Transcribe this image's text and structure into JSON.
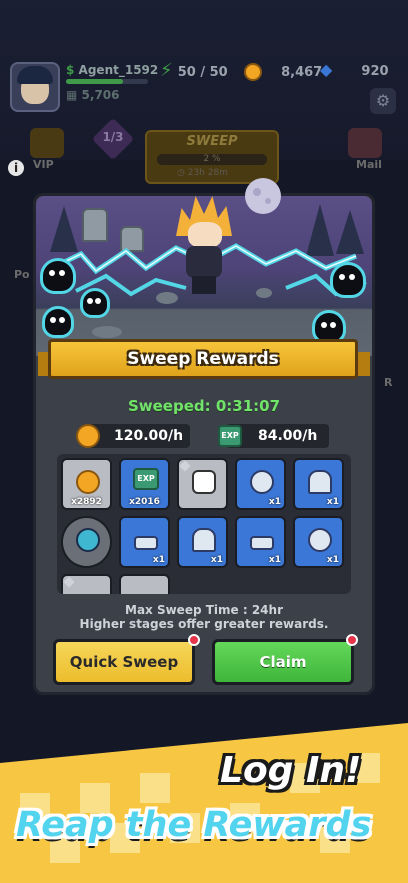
{
  "player": {
    "name": "Agent_1592",
    "power": "5,706",
    "energy": "50 / 50",
    "gold": "8,467",
    "gems": "920"
  },
  "side_menu": {
    "vip_label": "VIP",
    "mail_label": "Mail",
    "left_cut_label": "Po",
    "right_cut_label": "R"
  },
  "sweep_hud": {
    "stage": "1/3",
    "title": "SWEEP",
    "percent": "2 %",
    "timer": "23h 28m"
  },
  "dialog": {
    "title": "Sweep Rewards",
    "sweeped_label": "Sweeped: 0:31:07",
    "gold_rate": "120.00/h",
    "exp_rate": "84.00/h",
    "exp_icon_text": "EXP",
    "rewards": [
      {
        "icon": "gold-coin-icon",
        "qty": "x2892",
        "bg": "gray"
      },
      {
        "icon": "exp-book-icon",
        "qty": "x2016",
        "bg": "blue"
      },
      {
        "icon": "robot-gear-icon",
        "qty": "",
        "bg": "gray"
      },
      {
        "icon": "boots-icon",
        "qty": "x1",
        "bg": "blue"
      },
      {
        "icon": "hat-icon",
        "qty": "x1",
        "bg": "blue"
      },
      {
        "icon": "orb-icon",
        "qty": "",
        "bg": "teal"
      },
      {
        "icon": "belt-icon",
        "qty": "x1",
        "bg": "blue"
      },
      {
        "icon": "hat-icon",
        "qty": "x1",
        "bg": "blue"
      },
      {
        "icon": "belt-icon",
        "qty": "x1",
        "bg": "blue"
      },
      {
        "icon": "boots-icon",
        "qty": "x1",
        "bg": "blue"
      }
    ],
    "max_sweep_time": "Max Sweep Time : 24hr",
    "hint": "Higher stages offer greater rewards.",
    "quick_sweep_label": "Quick Sweep",
    "claim_label": "Claim"
  },
  "promo": {
    "line1": "Log In!",
    "line2": "Reap the Rewards"
  },
  "colors": {
    "accent_yellow": "#f6c53a",
    "claim_green": "#4fc84a",
    "sweeped_green": "#72e36a",
    "promo_cyan": "#52d4ef",
    "lightning": "#53d6e6"
  }
}
